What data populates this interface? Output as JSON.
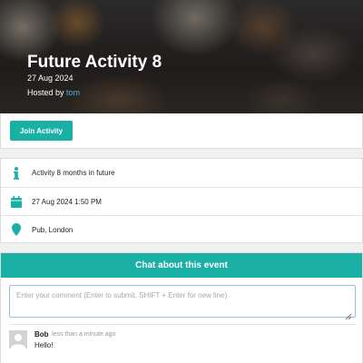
{
  "event": {
    "title": "Future Activity 8",
    "date": "27 Aug 2024",
    "hosted_by_label": "Hosted by",
    "host_name": "tom"
  },
  "actions": {
    "join_label": "Join Activity"
  },
  "details": {
    "description": {
      "icon": "info-icon",
      "text": "Activity 8 months in future"
    },
    "datetime": {
      "icon": "calendar-icon",
      "text": "27 Aug 2024 1:50 PM"
    },
    "location": {
      "icon": "map-marker-icon",
      "text": "Pub, London"
    }
  },
  "chat": {
    "header": "Chat about this event",
    "placeholder": "Enter your comment (Enter to submit, SHIFT + Enter for new line)",
    "messages": [
      {
        "author": "Bob",
        "time": "less than a minute ago",
        "text": "Hello!"
      }
    ]
  },
  "colors": {
    "accent": "#1ab0a6",
    "host_link": "#4fb2e6"
  }
}
